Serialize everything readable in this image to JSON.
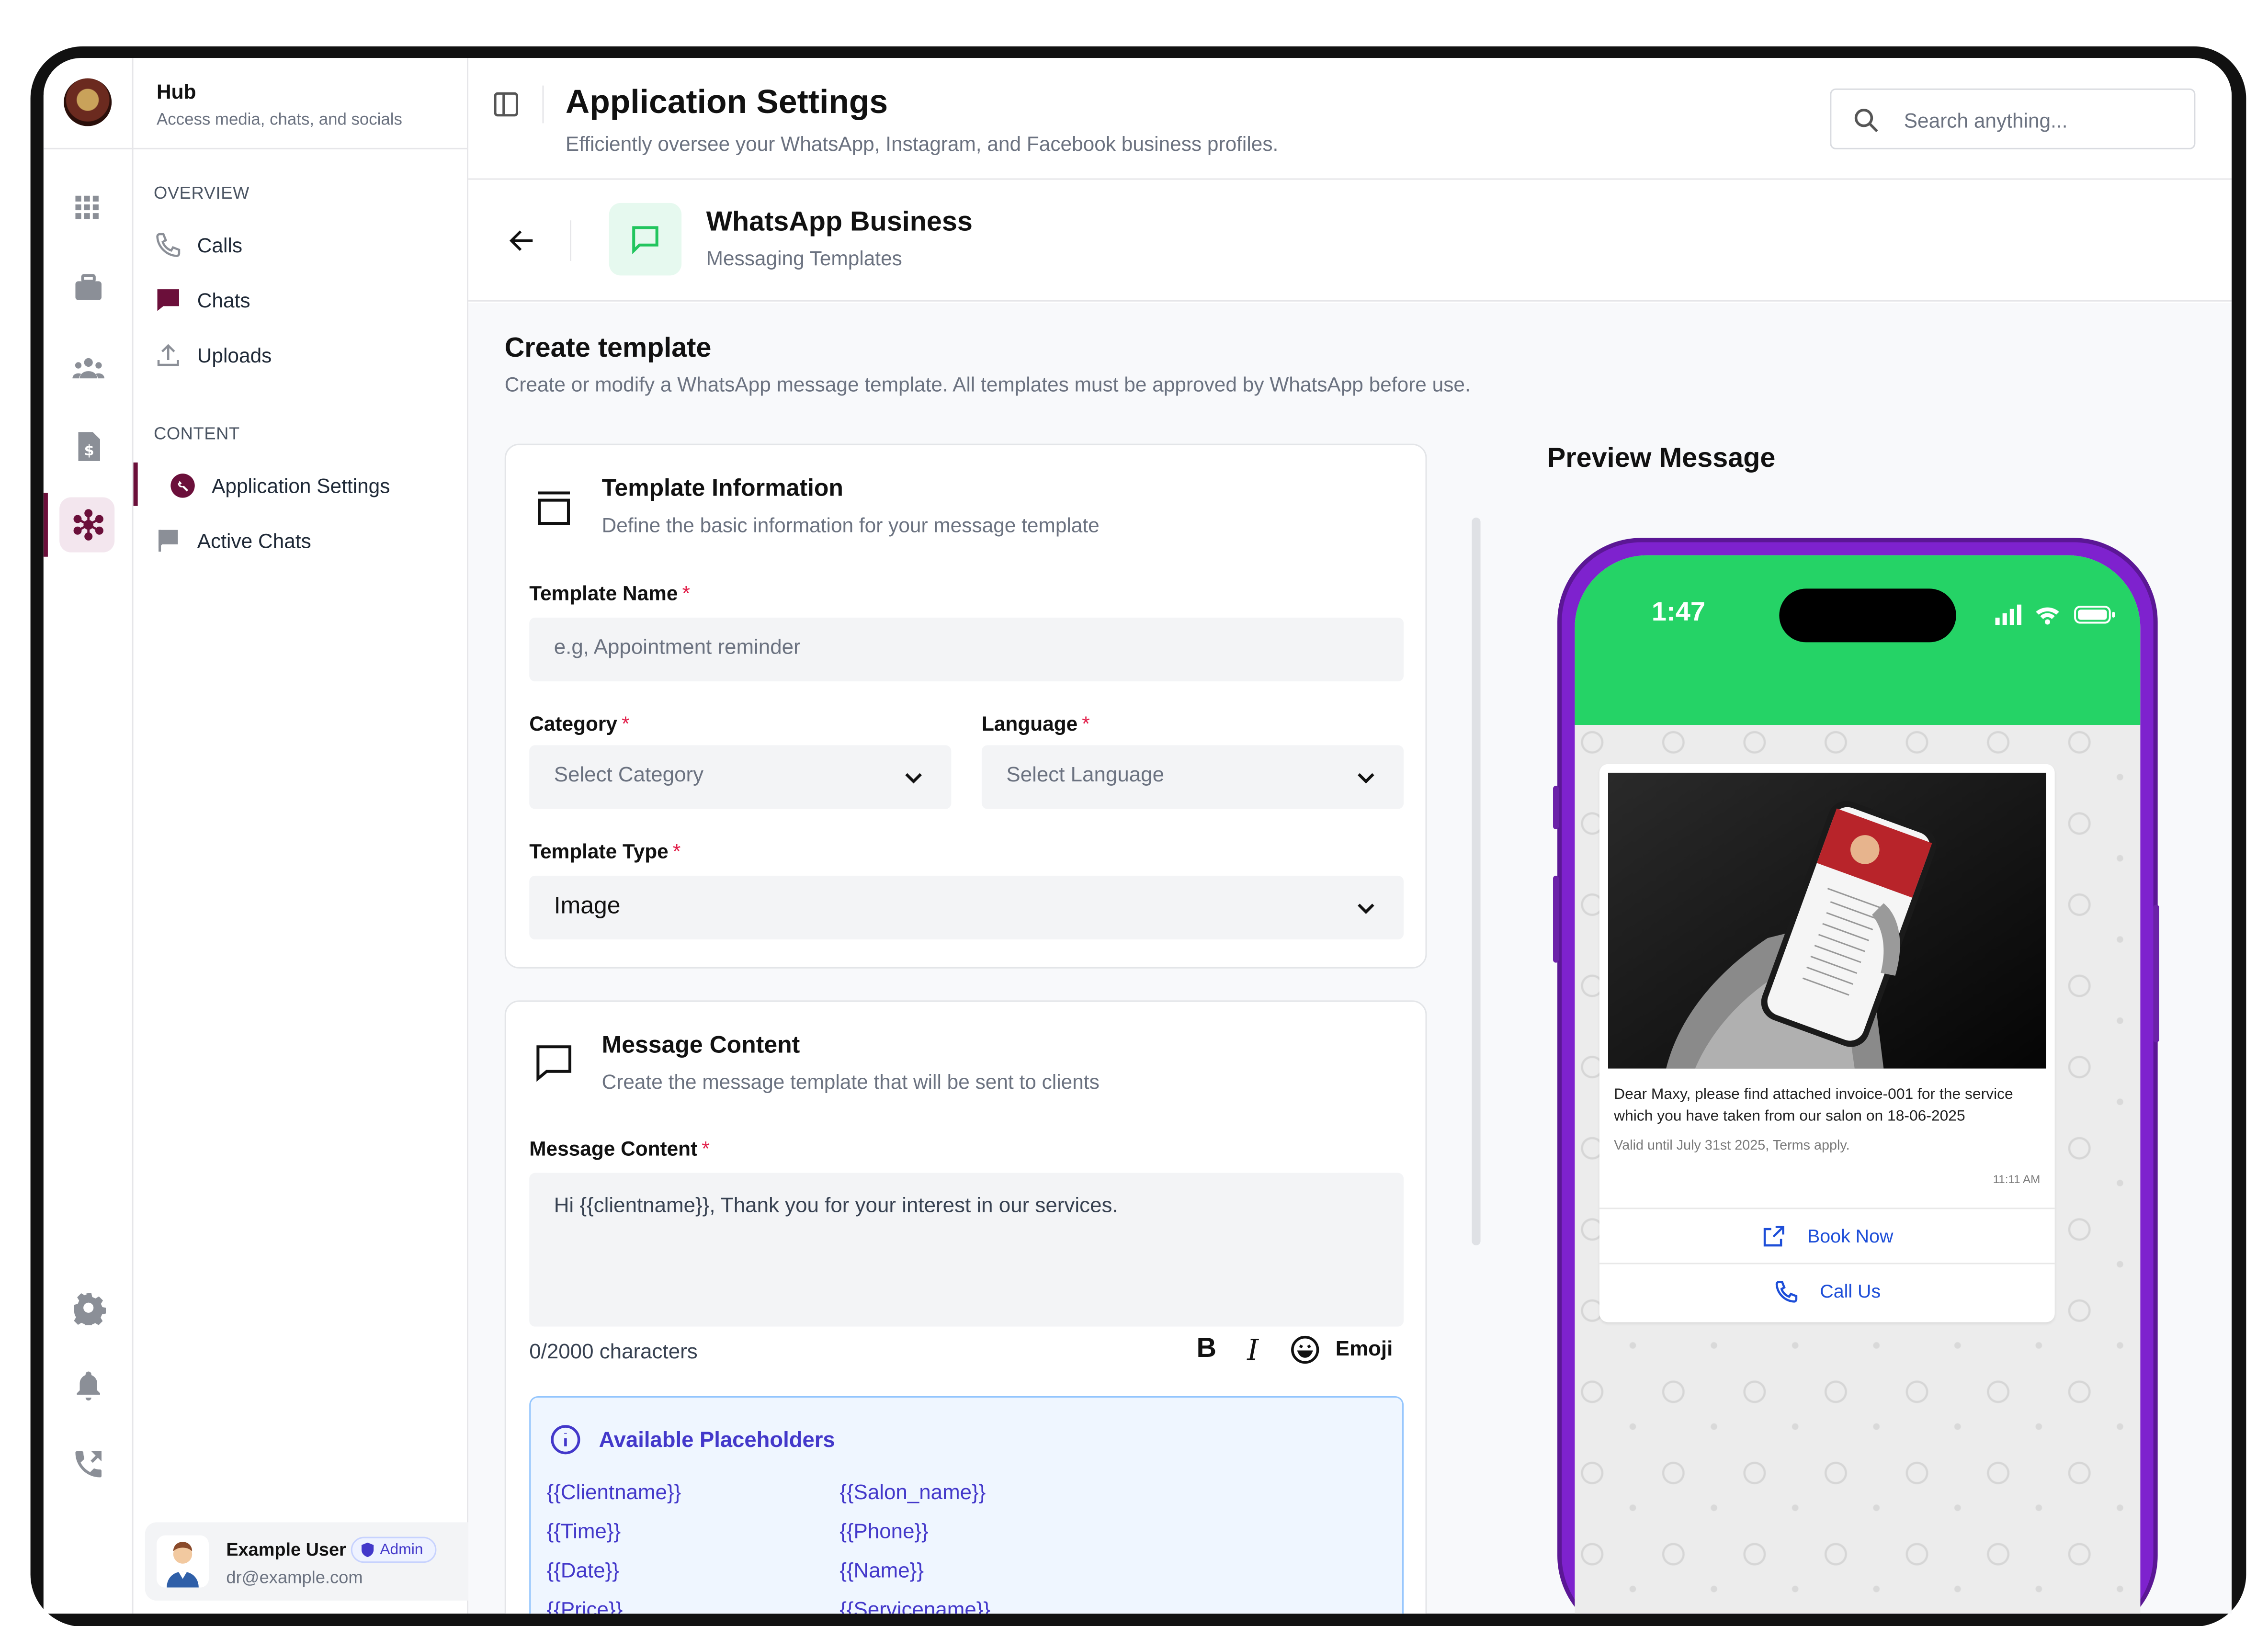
{
  "sidebar": {
    "title": "Hub",
    "subtitle": "Access media, chats, and socials",
    "overview_label": "OVERVIEW",
    "overview_items": [
      {
        "label": "Calls",
        "icon": "phone-icon"
      },
      {
        "label": "Chats",
        "icon": "chat-bubble-icon"
      },
      {
        "label": "Uploads",
        "icon": "upload-icon"
      }
    ],
    "content_label": "CONTENT",
    "content_items": [
      {
        "label": "Application Settings",
        "icon": "wrench-icon",
        "active": true
      },
      {
        "label": "Active Chats",
        "icon": "flag-chat-icon"
      }
    ],
    "rail_icons": [
      "dashboard-icon",
      "briefcase-icon",
      "users-icon",
      "invoice-icon",
      "network-icon",
      "settings-icon",
      "bell-icon",
      "phone-forward-icon"
    ]
  },
  "user": {
    "name": "Example User",
    "role": "Admin",
    "email": "dr@example.com"
  },
  "header": {
    "title": "Application Settings",
    "subtitle": "Efficiently oversee your WhatsApp, Instagram, and Facebook business profiles.",
    "search_placeholder": "Search anything..."
  },
  "subheader": {
    "title": "WhatsApp Business",
    "subtitle": "Messaging Templates"
  },
  "page": {
    "title": "Create template",
    "subtitle": "Create or modify a WhatsApp message template. All templates must be approved by WhatsApp before use."
  },
  "template_info": {
    "title": "Template Information",
    "subtitle": "Define the basic information for your message template",
    "name_label": "Template Name",
    "name_placeholder": "e.g, Appointment reminder",
    "category_label": "Category",
    "category_placeholder": "Select Category",
    "language_label": "Language",
    "language_placeholder": "Select Language",
    "type_label": "Template Type",
    "type_value": "Image",
    "required_mark": "*"
  },
  "message_content": {
    "title": "Message Content",
    "subtitle": "Create the message template that will be sent to clients",
    "field_label": "Message Content",
    "value": "Hi {{clientname}}, Thank you for your interest in our services.",
    "char_count": "0/2000 characters",
    "bold": "B",
    "italic": "I",
    "emoji_label": "Emoji"
  },
  "placeholders": {
    "title": "Available Placeholders",
    "left": [
      "{{Clientname}}",
      "{{Time}}",
      "{{Date}}",
      "{{Price}}"
    ],
    "right": [
      "{{Salon_name}}",
      "{{Phone}}",
      "{{Name}}",
      "{{Servicename}}"
    ]
  },
  "preview": {
    "title": "Preview Message",
    "time": "1:47",
    "message": "Dear Maxy, please find attached  invoice-001 for the service which you have taken from our salon on 18-06-2025",
    "footer": "Valid until July 31st 2025, Terms apply.",
    "timestamp": "11:11 AM",
    "button1": "Book Now",
    "button2": "Call Us",
    "colors": {
      "status_bar": "#25d366",
      "phone_frame": "#7e22ce",
      "link": "#1d4ed8"
    }
  }
}
